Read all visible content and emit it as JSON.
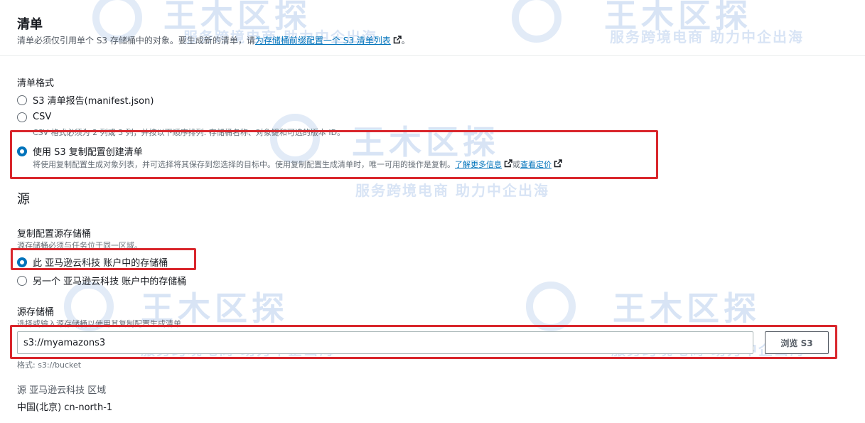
{
  "manifest": {
    "title": "清单",
    "description_prefix": "清单必须仅引用单个 S3 存储桶中的对象。要生成新的清单，请",
    "description_link": "为存储桶前缀配置一个 S3 清单列表",
    "description_suffix": "。",
    "format_label": "清单格式",
    "options": [
      {
        "label": "S3 清单报告(manifest.json)",
        "selected": false
      },
      {
        "label": "CSV",
        "selected": false,
        "hint": "CSV 格式必须为 2 列或 3 列，并按以下顺序排列: 存储桶名称、对象键和可选的版本 ID。"
      },
      {
        "label": "使用 S3 复制配置创建清单",
        "selected": true,
        "hint": "将使用复制配置生成对象列表，并可选择将其保存到您选择的目标中。使用复制配置生成清单时，唯一可用的操作是复制。",
        "learn_more": "了解更多信息",
        "or_text": "或",
        "pricing": "查看定价"
      }
    ]
  },
  "source": {
    "title": "源",
    "bucket_label": "复制配置源存储桶",
    "bucket_hint": "源存储桶必须与任务位于同一区域。",
    "bucket_options": [
      {
        "label": "此 亚马逊云科技 账户中的存储桶",
        "selected": true
      },
      {
        "label": "另一个 亚马逊云科技 账户中的存储桶",
        "selected": false
      }
    ],
    "source_bucket_label": "源存储桶",
    "source_bucket_hint": "选择或输入源存储桶以使用其复制配置生成清单",
    "source_bucket_value": "s3://myamazons3",
    "browse_label": "浏览 S3",
    "format_hint": "格式: s3://bucket",
    "region_label": "源 亚马逊云科技 区域",
    "region_value": "中国(北京) cn-north-1"
  },
  "watermark": {
    "logo": "王木区探",
    "slogan": "服务跨境电商  助力中企出海"
  },
  "colors": {
    "accent": "#0073bb",
    "highlight": "#d9262c",
    "watermark": "#2f6fc9"
  }
}
